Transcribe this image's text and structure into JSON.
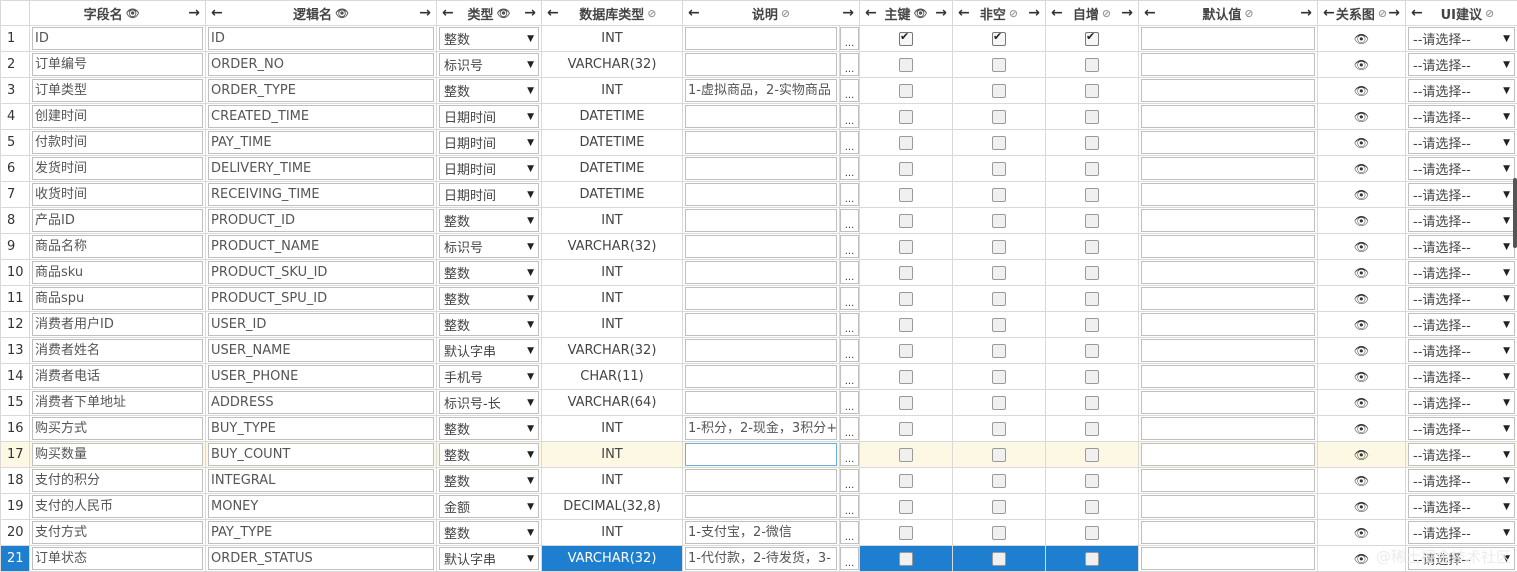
{
  "headers": {
    "field_name": "字段名",
    "logic_name": "逻辑名",
    "type": "类型",
    "db_type": "数据库类型",
    "description": "说明",
    "primary_key": "主键",
    "not_null": "非空",
    "auto_inc": "自增",
    "default_value": "默认值",
    "relation": "关系图",
    "ui_suggest": "UI建议"
  },
  "icons": {
    "arrow_left": "←",
    "arrow_right": "→",
    "eye": "👁",
    "eye_off": "⊘",
    "caret": "▼",
    "dots": "...",
    "checkmark": "✔"
  },
  "ui_placeholder": "--请选择--",
  "rows": [
    {
      "no": "1",
      "name": "ID",
      "code": "ID",
      "type": "整数",
      "db": "INT",
      "desc": "",
      "pk": true,
      "nn": true,
      "ai": true
    },
    {
      "no": "2",
      "name": "订单编号",
      "code": "ORDER_NO",
      "type": "标识号",
      "db": "VARCHAR(32)",
      "desc": "",
      "pk": false,
      "nn": false,
      "ai": false
    },
    {
      "no": "3",
      "name": "订单类型",
      "code": "ORDER_TYPE",
      "type": "整数",
      "db": "INT",
      "desc": "1-虚拟商品，2-实物商品",
      "pk": false,
      "nn": false,
      "ai": false
    },
    {
      "no": "4",
      "name": "创建时间",
      "code": "CREATED_TIME",
      "type": "日期时间",
      "db": "DATETIME",
      "desc": "",
      "pk": false,
      "nn": false,
      "ai": false
    },
    {
      "no": "5",
      "name": "付款时间",
      "code": "PAY_TIME",
      "type": "日期时间",
      "db": "DATETIME",
      "desc": "",
      "pk": false,
      "nn": false,
      "ai": false
    },
    {
      "no": "6",
      "name": "发货时间",
      "code": "DELIVERY_TIME",
      "type": "日期时间",
      "db": "DATETIME",
      "desc": "",
      "pk": false,
      "nn": false,
      "ai": false
    },
    {
      "no": "7",
      "name": "收货时间",
      "code": "RECEIVING_TIME",
      "type": "日期时间",
      "db": "DATETIME",
      "desc": "",
      "pk": false,
      "nn": false,
      "ai": false
    },
    {
      "no": "8",
      "name": "产品ID",
      "code": "PRODUCT_ID",
      "type": "整数",
      "db": "INT",
      "desc": "",
      "pk": false,
      "nn": false,
      "ai": false
    },
    {
      "no": "9",
      "name": "商品名称",
      "code": "PRODUCT_NAME",
      "type": "标识号",
      "db": "VARCHAR(32)",
      "desc": "",
      "pk": false,
      "nn": false,
      "ai": false
    },
    {
      "no": "10",
      "name": "商品sku",
      "code": "PRODUCT_SKU_ID",
      "type": "整数",
      "db": "INT",
      "desc": "",
      "pk": false,
      "nn": false,
      "ai": false
    },
    {
      "no": "11",
      "name": "商品spu",
      "code": "PRODUCT_SPU_ID",
      "type": "整数",
      "db": "INT",
      "desc": "",
      "pk": false,
      "nn": false,
      "ai": false
    },
    {
      "no": "12",
      "name": "消费者用户ID",
      "code": "USER_ID",
      "type": "整数",
      "db": "INT",
      "desc": "",
      "pk": false,
      "nn": false,
      "ai": false
    },
    {
      "no": "13",
      "name": "消费者姓名",
      "code": "USER_NAME",
      "type": "默认字串",
      "db": "VARCHAR(32)",
      "desc": "",
      "pk": false,
      "nn": false,
      "ai": false
    },
    {
      "no": "14",
      "name": "消费者电话",
      "code": "USER_PHONE",
      "type": "手机号",
      "db": "CHAR(11)",
      "desc": "",
      "pk": false,
      "nn": false,
      "ai": false
    },
    {
      "no": "15",
      "name": "消费者下单地址",
      "code": "ADDRESS",
      "type": "标识号-长",
      "db": "VARCHAR(64)",
      "desc": "",
      "pk": false,
      "nn": false,
      "ai": false
    },
    {
      "no": "16",
      "name": "购买方式",
      "code": "BUY_TYPE",
      "type": "整数",
      "db": "INT",
      "desc": "1-积分，2-现金，3积分+",
      "pk": false,
      "nn": false,
      "ai": false
    },
    {
      "no": "17",
      "name": "购买数量",
      "code": "BUY_COUNT",
      "type": "整数",
      "db": "INT",
      "desc": "",
      "pk": false,
      "nn": false,
      "ai": false
    },
    {
      "no": "18",
      "name": "支付的积分",
      "code": "INTEGRAL",
      "type": "整数",
      "db": "INT",
      "desc": "",
      "pk": false,
      "nn": false,
      "ai": false
    },
    {
      "no": "19",
      "name": "支付的人民币",
      "code": "MONEY",
      "type": "金额",
      "db": "DECIMAL(32,8)",
      "desc": "",
      "pk": false,
      "nn": false,
      "ai": false
    },
    {
      "no": "20",
      "name": "支付方式",
      "code": "PAY_TYPE",
      "type": "整数",
      "db": "INT",
      "desc": "1-支付宝，2-微信",
      "pk": false,
      "nn": false,
      "ai": false
    },
    {
      "no": "21",
      "name": "订单状态",
      "code": "ORDER_STATUS",
      "type": "默认字串",
      "db": "VARCHAR(32)",
      "desc": "1-代付款，2-待发货，3-",
      "pk": false,
      "nn": false,
      "ai": false
    }
  ],
  "hover_row": 17,
  "selected_row": 21,
  "watermark": "@稀土掘金技术社区"
}
